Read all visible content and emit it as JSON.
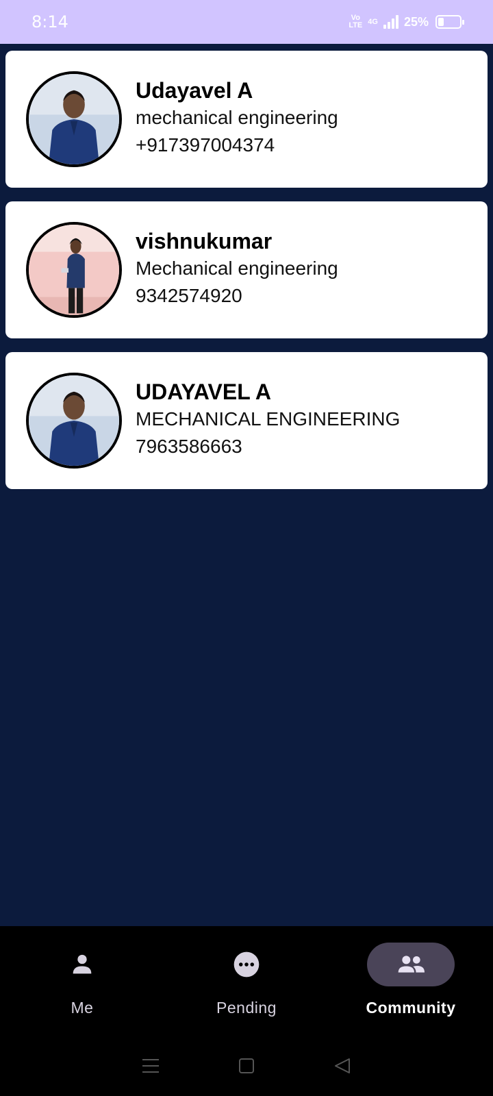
{
  "status_bar": {
    "time": "8:14",
    "volte": "Vo LTE",
    "network": "4G",
    "battery": "25%",
    "battery_level": 0.25
  },
  "contacts": [
    {
      "name": "Udayavel A",
      "department": "mechanical engineering",
      "phone": "+917397004374",
      "avatar": "person-photo-avatar"
    },
    {
      "name": "vishnukumar",
      "department": "Mechanical engineering",
      "phone": "9342574920",
      "avatar": "person-photo-avatar"
    },
    {
      "name": "UDAYAVEL A",
      "department": "MECHANICAL ENGINEERING",
      "phone": "7963586663",
      "avatar": "person-photo-avatar"
    }
  ],
  "bottom_nav": {
    "items": [
      {
        "label": "Me",
        "icon": "person-icon",
        "active": false
      },
      {
        "label": "Pending",
        "icon": "more-horizontal-circle-icon",
        "active": false
      },
      {
        "label": "Community",
        "icon": "group-icon",
        "active": true
      }
    ]
  },
  "system_nav": {
    "icons": [
      "menu-icon",
      "home-square-icon",
      "back-triangle-icon"
    ]
  },
  "colors": {
    "status_bar": "#d1c4ff",
    "background": "#0c1b3d",
    "card": "#ffffff",
    "nav_bar": "#000000",
    "active_pill": "#4a4458"
  }
}
